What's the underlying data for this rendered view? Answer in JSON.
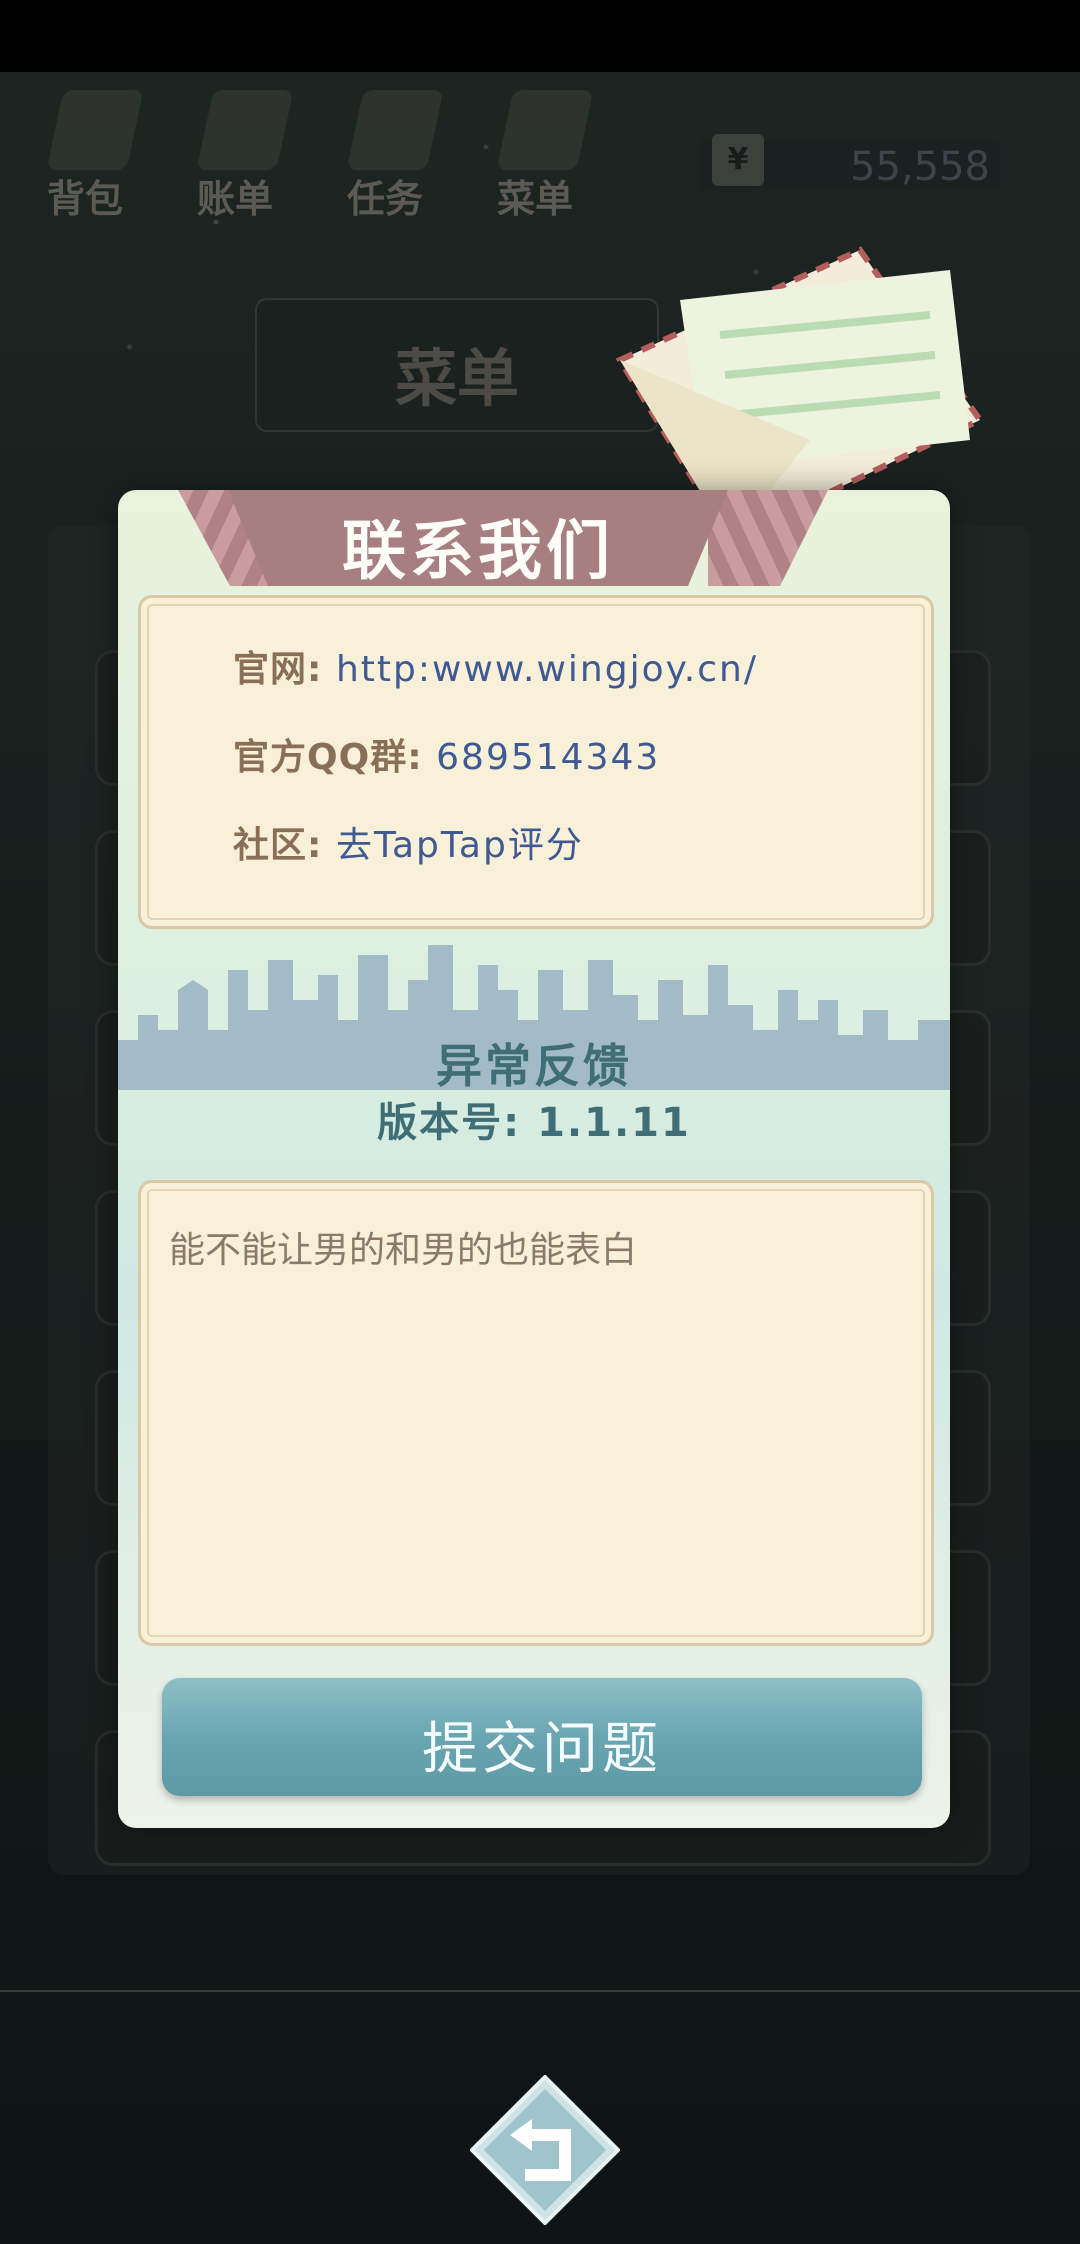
{
  "nav": {
    "items": [
      {
        "label": "背包",
        "icon": "bag-icon"
      },
      {
        "label": "账单",
        "icon": "bill-icon"
      },
      {
        "label": "任务",
        "icon": "task-icon"
      },
      {
        "label": "菜单",
        "icon": "menu-icon"
      }
    ]
  },
  "money": {
    "currency_icon": "¥",
    "amount": "55,558"
  },
  "background": {
    "title": "菜单"
  },
  "dialog": {
    "title": "联系我们",
    "contact": {
      "website_label": "官网:",
      "website_value": "http:www.wingjoy.cn/",
      "qq_label": "官方QQ群:",
      "qq_value": "689514343",
      "community_label": "社区:",
      "community_value": "去TapTap评分"
    },
    "feedback": {
      "title": "异常反馈",
      "version": "版本号: 1.1.11",
      "text": "能不能让男的和男的也能表白"
    },
    "submit_label": "提交问题"
  },
  "colors": {
    "ribbon": "#a77f80",
    "link": "#3f5a93",
    "button": "#6aa6b2"
  }
}
